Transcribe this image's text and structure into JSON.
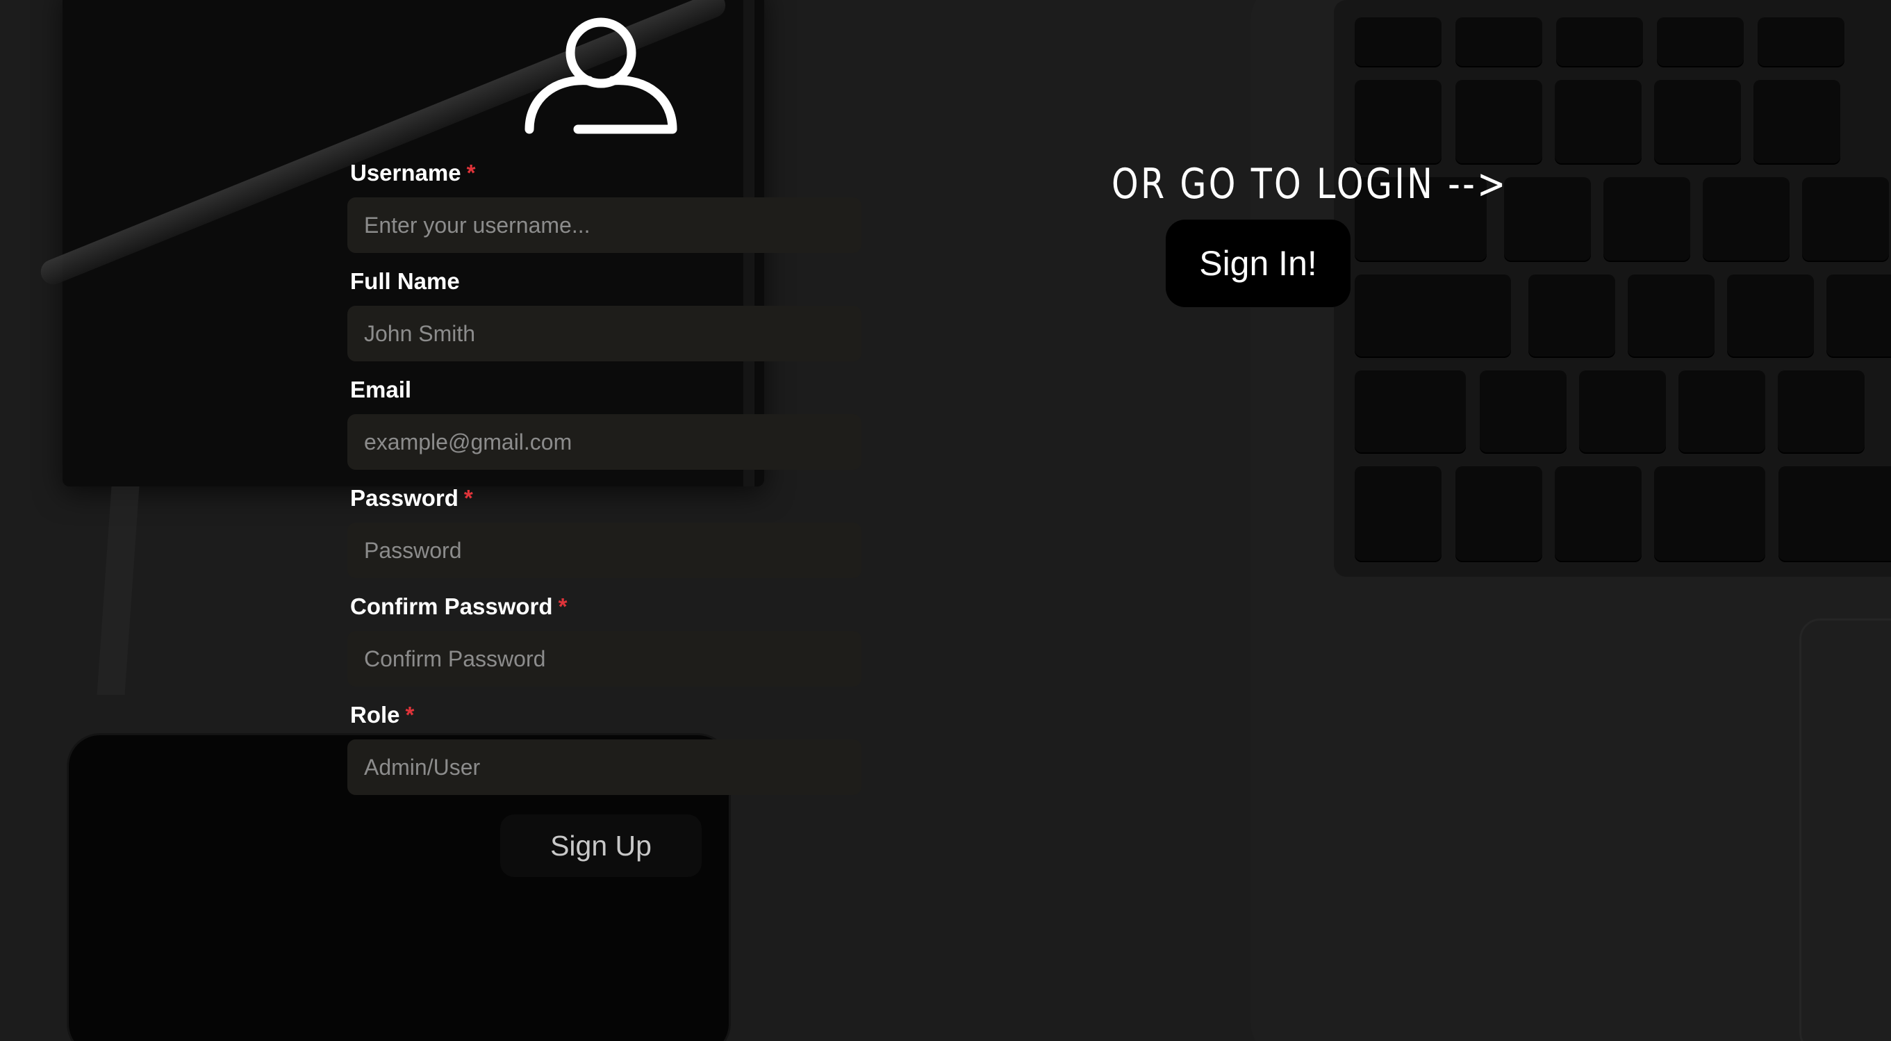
{
  "icons": {
    "user": "user-outline-icon"
  },
  "colors": {
    "required_asterisk": "#e0343a",
    "input_background": "#1e1d1a",
    "page_background": "#1c1c1c"
  },
  "form": {
    "fields": [
      {
        "label": "Username",
        "required": "*",
        "placeholder": "Enter your username..."
      },
      {
        "label": "Full Name",
        "required": "",
        "placeholder": "John Smith"
      },
      {
        "label": "Email",
        "required": "",
        "placeholder": "example@gmail.com"
      },
      {
        "label": "Password",
        "required": "*",
        "placeholder": "Password"
      },
      {
        "label": "Confirm Password",
        "required": "*",
        "placeholder": "Confirm Password"
      },
      {
        "label": "Role",
        "required": "*",
        "placeholder": "Admin/User"
      }
    ],
    "submit_label": "Sign Up"
  },
  "login": {
    "prompt": "OR GO TO LOGIN -->",
    "button_label": "Sign In!"
  }
}
